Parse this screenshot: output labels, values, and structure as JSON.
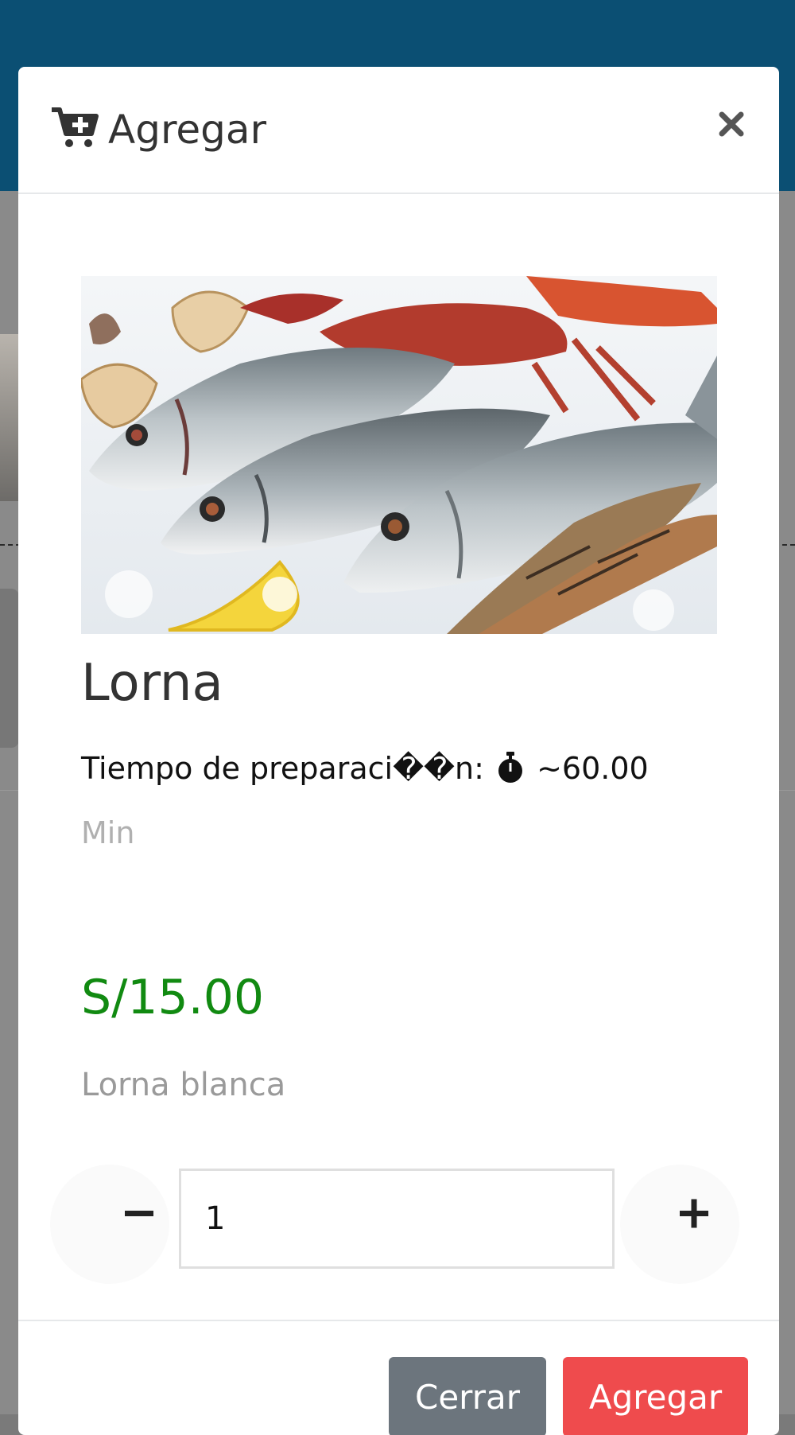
{
  "modal": {
    "title": "Agregar",
    "close_symbol": "×",
    "icons": {
      "header": "cart-plus-icon",
      "close": "close-icon",
      "prep": "stopwatch-icon",
      "minus": "minus-icon",
      "plus": "plus-icon"
    }
  },
  "product": {
    "name": "Lorna",
    "prep_label": "Tiempo de preparaci��n:",
    "prep_value": "~60.00",
    "prep_unit": "Min",
    "price": "S/15.00",
    "description": "Lorna blanca",
    "quantity": "1"
  },
  "footer": {
    "close_label": "Cerrar",
    "add_label": "Agregar"
  },
  "colors": {
    "header_bg": "#0b4f73",
    "price": "#118a11",
    "btn_close": "#6c757d",
    "btn_add": "#ef4b4d"
  }
}
